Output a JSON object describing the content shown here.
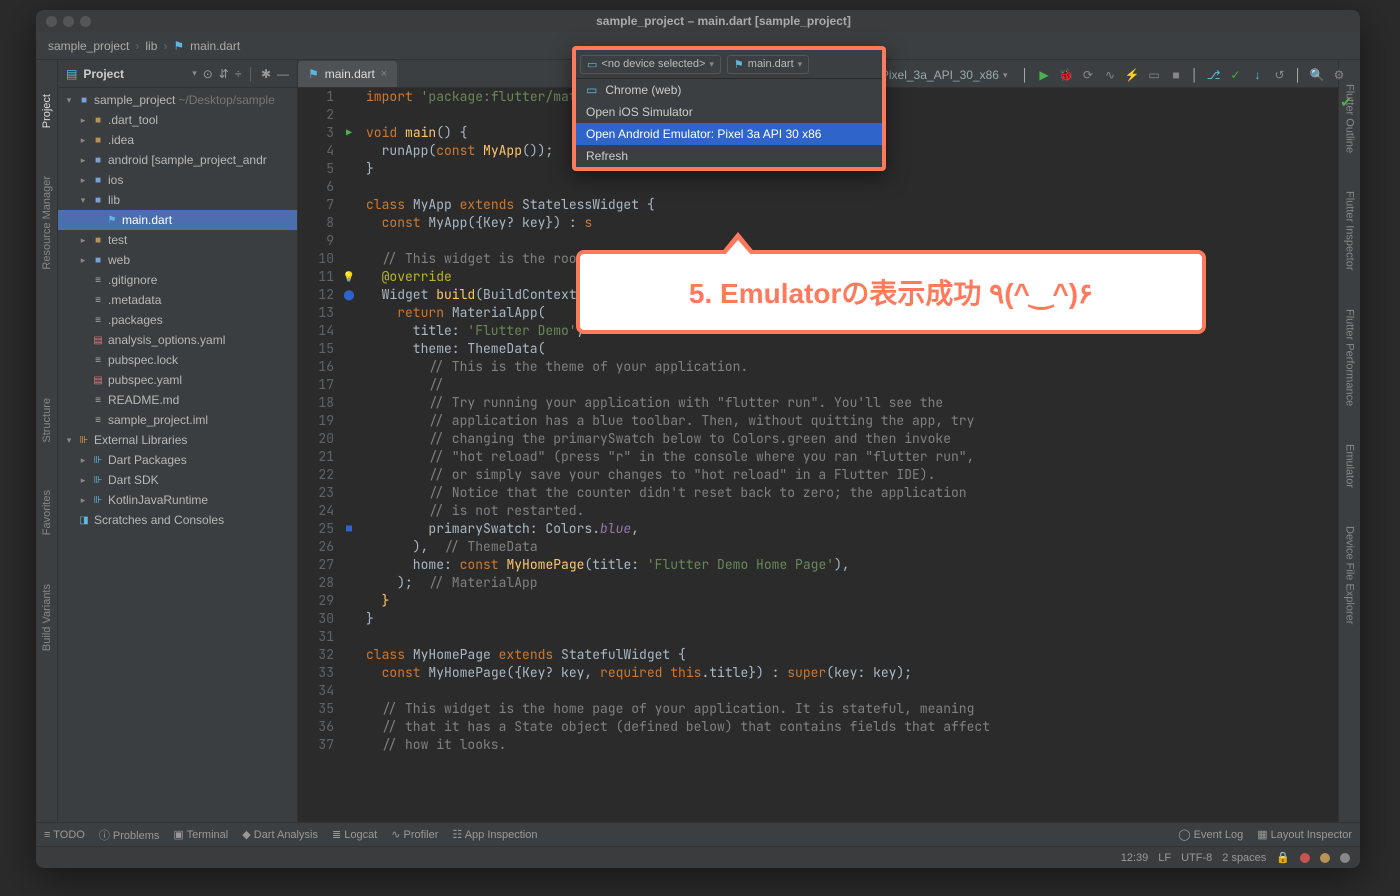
{
  "window_title": "sample_project – main.dart [sample_project]",
  "breadcrumbs": [
    "sample_project",
    "lib",
    "main.dart"
  ],
  "project_label": "Project",
  "dropdown": {
    "no_device": "<no device selected>",
    "run_config": "main.dart",
    "open_tab": "Pixel_3a_API_30_x86",
    "items": [
      "Chrome (web)",
      "Open iOS Simulator",
      "Open Android Emulator: Pixel 3a API 30 x86",
      "Refresh"
    ]
  },
  "annotation": "5. Emulatorの表示成功 ٩(^‿^)۶",
  "left_tabs": [
    "Project",
    "Resource Manager",
    "Structure",
    "Favorites",
    "Build Variants"
  ],
  "right_tabs": [
    "Flutter Outline",
    "Flutter Inspector",
    "Flutter Performance",
    "Emulator",
    "Device File Explorer"
  ],
  "tree": {
    "root": "sample_project",
    "root_path": "~/Desktop/sample",
    "items": [
      {
        "d": 1,
        "exp": false,
        "ico": "folder",
        "label": ".dart_tool"
      },
      {
        "d": 1,
        "exp": false,
        "ico": "folder",
        "label": ".idea"
      },
      {
        "d": 1,
        "exp": false,
        "ico": "folder-blue",
        "label": "android [sample_project_andr"
      },
      {
        "d": 1,
        "exp": false,
        "ico": "folder-blue",
        "label": "ios"
      },
      {
        "d": 1,
        "exp": true,
        "ico": "folder-blue",
        "label": "lib"
      },
      {
        "d": 2,
        "exp": null,
        "ico": "dart",
        "label": "main.dart",
        "sel": true
      },
      {
        "d": 1,
        "exp": false,
        "ico": "folder",
        "label": "test"
      },
      {
        "d": 1,
        "exp": false,
        "ico": "folder-blue",
        "label": "web"
      },
      {
        "d": 1,
        "exp": null,
        "ico": "txt",
        "label": ".gitignore"
      },
      {
        "d": 1,
        "exp": null,
        "ico": "txt",
        "label": ".metadata"
      },
      {
        "d": 1,
        "exp": null,
        "ico": "txt",
        "label": ".packages"
      },
      {
        "d": 1,
        "exp": null,
        "ico": "yaml",
        "label": "analysis_options.yaml"
      },
      {
        "d": 1,
        "exp": null,
        "ico": "txt",
        "label": "pubspec.lock"
      },
      {
        "d": 1,
        "exp": null,
        "ico": "yaml",
        "label": "pubspec.yaml"
      },
      {
        "d": 1,
        "exp": null,
        "ico": "txt",
        "label": "README.md"
      },
      {
        "d": 1,
        "exp": null,
        "ico": "txt",
        "label": "sample_project.iml"
      }
    ],
    "ext_lib": "External Libraries",
    "ext_items": [
      "Dart Packages",
      "Dart SDK",
      "KotlinJavaRuntime"
    ],
    "scratches": "Scratches and Consoles"
  },
  "tab_file": "main.dart",
  "code_lines": [
    "<kw>import</kw> <str>'package:flutter/materi</str>",
    "",
    "<kw>void</kw> <fn>main</fn>() {",
    "  runApp(<kw>const</kw> <fn>MyApp</fn>());",
    "}",
    "",
    "<kw>class</kw> MyApp <kw>extends</kw> StatelessWidget {",
    "  <kw>const</kw> MyApp({Key? key}) : <kw>s</kw>",
    "",
    "  <com>// This widget is the root</com>",
    "  <anno>@override</anno>",
    "  Widget <fn>build</fn>(BuildContext c",
    "    <kw>return</kw> MaterialApp(",
    "      title: <str>'Flutter Demo'</str>,",
    "      theme: ThemeData(",
    "        <com>// This is the theme of your application.</com>",
    "        <com>//</com>",
    "        <com>// Try running your application with \"flutter run\". You'll see the</com>",
    "        <com>// application has a blue toolbar. Then, without quitting the app, try</com>",
    "        <com>// changing the primarySwatch below to Colors.green and then invoke</com>",
    "        <com>// \"hot reload\" (press \"r\" in the console where you ran \"flutter run\",</com>",
    "        <com>// or simply save your changes to \"hot reload\" in a Flutter IDE).</com>",
    "        <com>// Notice that the counter didn't reset back to zero; the application</com>",
    "        <com>// is not restarted.</com>",
    "        primarySwatch: Colors.<ital>blue</ital>,",
    "      ),  <com>// ThemeData</com>",
    "      home: <kw>const</kw> <fn>MyHomePage</fn>(title: <str>'Flutter Demo Home Page'</str>),",
    "    );  <com>// MaterialApp</com>",
    "  <fn>}</fn>",
    "}",
    "",
    "<kw>class</kw> MyHomePage <kw>extends</kw> StatefulWidget {",
    "  <kw>const</kw> MyHomePage({Key? key, <kw>required this</kw>.title}) : <kw>super</kw>(key: key);",
    "",
    "  <com>// This widget is the home page of your application. It is stateful, meaning</com>",
    "  <com>// that it has a State object (defined below) that contains fields that affect</com>",
    "  <com>// how it looks.</com>"
  ],
  "bottom": [
    "TODO",
    "Problems",
    "Terminal",
    "Dart Analysis",
    "Logcat",
    "Profiler",
    "App Inspection"
  ],
  "bottom_right": [
    "Event Log",
    "Layout Inspector"
  ],
  "status": {
    "time": "12:39",
    "lf": "LF",
    "enc": "UTF-8",
    "indent": "2 spaces"
  }
}
